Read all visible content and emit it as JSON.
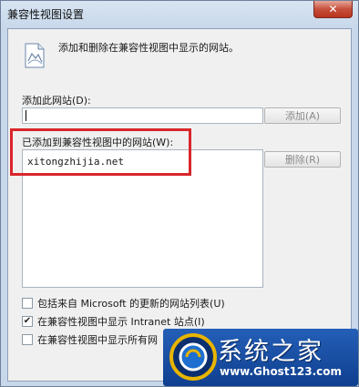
{
  "window": {
    "title": "兼容性视图设置",
    "close_label": "✕"
  },
  "intro": {
    "text": "添加和删除在兼容性视图中显示的网站。"
  },
  "add_site": {
    "label": "添加此网站(D):",
    "value": "",
    "button_label": "添加(A)"
  },
  "site_list": {
    "label": "已添加到兼容性视图中的网站(W):",
    "items": [
      "xitongzhijia.net"
    ],
    "remove_button_label": "删除(R)"
  },
  "options": [
    {
      "label": "包括来自 Microsoft 的更新的网站列表(U)",
      "checked": false
    },
    {
      "label": "在兼容性视图中显示 Intranet 站点(I)",
      "checked": true
    },
    {
      "label": "在兼容性视图中显示所有网",
      "checked": false
    }
  ],
  "watermark": {
    "name": "系统之家",
    "url": "www.Ghost123.com"
  },
  "colors": {
    "highlight_border": "#d9262b",
    "watermark_bg": "#1a4fa3"
  },
  "icons": {
    "page_icon": "globe-page-icon",
    "close": "close-icon",
    "check": "checkmark-icon"
  }
}
